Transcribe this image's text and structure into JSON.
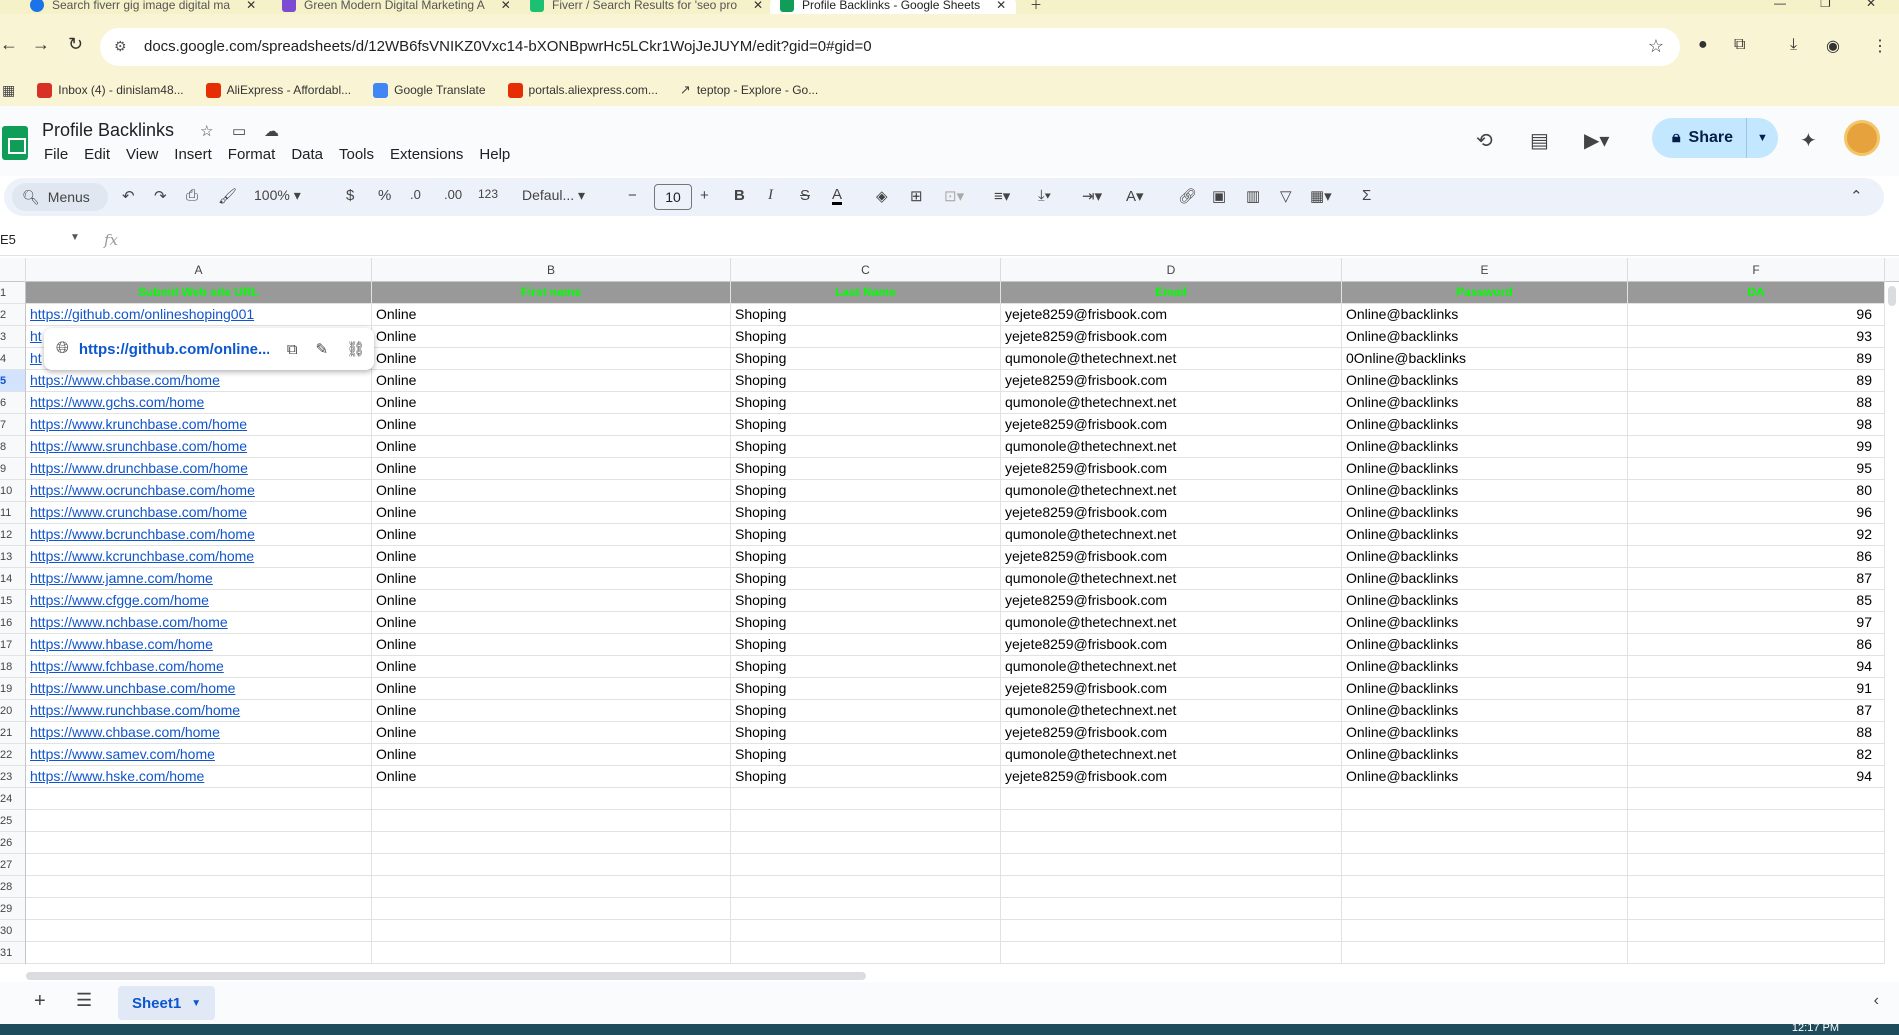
{
  "browser": {
    "tabs": [
      {
        "label": "Search fiverr gig image digital ma",
        "color": "#1a73e8"
      },
      {
        "label": "Green Modern Digital Marketing A",
        "color": "#7b4bd3"
      },
      {
        "label": "Fiverr / Search Results for 'seo pro",
        "color": "#1dbf73"
      },
      {
        "label": "Profile Backlinks - Google Sheets",
        "color": "#0f9d58"
      }
    ],
    "url": "docs.google.com/spreadsheets/d/12WB6fsVNIKZ0Vxc14-bXONBpwrHc5LCkr1WojJeJUYM/edit?gid=0#gid=0",
    "bookmarks": [
      {
        "label": "Inbox (4) - dinislam48...",
        "color": "#d93025"
      },
      {
        "label": "AliExpress - Affordabl...",
        "color": "#e62e04"
      },
      {
        "label": "Google Translate",
        "color": "#4285f4"
      },
      {
        "label": "portals.aliexpress.com...",
        "color": "#e62e04"
      },
      {
        "label": "teptop - Explore - Go...",
        "color": "#444444"
      }
    ]
  },
  "sheets": {
    "title": "Profile Backlinks",
    "menu": [
      "File",
      "Edit",
      "View",
      "Insert",
      "Format",
      "Data",
      "Tools",
      "Extensions",
      "Help"
    ],
    "share_label": "Share",
    "toolbar": {
      "menus_label": "Menus",
      "zoom": "100%",
      "currency": "$",
      "percent": "%",
      "dec_less": ".0",
      "dec_more": ".00",
      "number_format": "123",
      "font": "Defaul...",
      "font_size": "10"
    },
    "name_box": "E5",
    "fx_label": "fx",
    "columns": [
      "A",
      "B",
      "C",
      "D",
      "E",
      "F"
    ],
    "header_row": [
      "Submit Web site URL",
      "First name",
      "Last Name",
      "Email",
      "Password",
      "DA"
    ],
    "rows": [
      [
        "https://github.com/onlineshoping001",
        "Online",
        "Shoping",
        "yejete8259@frisbook.com",
        "Online@backlinks",
        "96"
      ],
      [
        "ht",
        "Online",
        "Shoping",
        "yejete8259@frisbook.com",
        "Online@backlinks",
        "93"
      ],
      [
        "ht",
        "Online",
        "Shoping",
        "qumonole@thetechnext.net",
        "0Online@backlinks",
        "89"
      ],
      [
        "https://www.chbase.com/home",
        "Online",
        "Shoping",
        "yejete8259@frisbook.com",
        "Online@backlinks",
        "89"
      ],
      [
        "https://www.gchs.com/home",
        "Online",
        "Shoping",
        "qumonole@thetechnext.net",
        "Online@backlinks",
        "88"
      ],
      [
        "https://www.krunchbase.com/home",
        "Online",
        "Shoping",
        "yejete8259@frisbook.com",
        "Online@backlinks",
        "98"
      ],
      [
        "https://www.srunchbase.com/home",
        "Online",
        "Shoping",
        "qumonole@thetechnext.net",
        "Online@backlinks",
        "99"
      ],
      [
        "https://www.drunchbase.com/home",
        "Online",
        "Shoping",
        "yejete8259@frisbook.com",
        "Online@backlinks",
        "95"
      ],
      [
        "https://www.ocrunchbase.com/home",
        "Online",
        "Shoping",
        "qumonole@thetechnext.net",
        "Online@backlinks",
        "80"
      ],
      [
        "https://www.crunchbase.com/home",
        "Online",
        "Shoping",
        "yejete8259@frisbook.com",
        "Online@backlinks",
        "96"
      ],
      [
        "https://www.bcrunchbase.com/home",
        "Online",
        "Shoping",
        "qumonole@thetechnext.net",
        "Online@backlinks",
        "92"
      ],
      [
        "https://www.kcrunchbase.com/home",
        "Online",
        "Shoping",
        "yejete8259@frisbook.com",
        "Online@backlinks",
        "86"
      ],
      [
        "https://www.jamne.com/home",
        "Online",
        "Shoping",
        "qumonole@thetechnext.net",
        "Online@backlinks",
        "87"
      ],
      [
        "https://www.cfgge.com/home",
        "Online",
        "Shoping",
        "yejete8259@frisbook.com",
        "Online@backlinks",
        "85"
      ],
      [
        "https://www.nchbase.com/home",
        "Online",
        "Shoping",
        "qumonole@thetechnext.net",
        "Online@backlinks",
        "97"
      ],
      [
        "https://www.hbase.com/home",
        "Online",
        "Shoping",
        "yejete8259@frisbook.com",
        "Online@backlinks",
        "86"
      ],
      [
        "https://www.fchbase.com/home",
        "Online",
        "Shoping",
        "qumonole@thetechnext.net",
        "Online@backlinks",
        "94"
      ],
      [
        "https://www.unchbase.com/home",
        "Online",
        "Shoping",
        "yejete8259@frisbook.com",
        "Online@backlinks",
        "91"
      ],
      [
        "https://www.runchbase.com/home",
        "Online",
        "Shoping",
        "qumonole@thetechnext.net",
        "Online@backlinks",
        "87"
      ],
      [
        "https://www.chbase.com/home",
        "Online",
        "Shoping",
        "yejete8259@frisbook.com",
        "Online@backlinks",
        "88"
      ],
      [
        "https://www.samev.com/home",
        "Online",
        "Shoping",
        "qumonole@thetechnext.net",
        "Online@backlinks",
        "82"
      ],
      [
        "https://www.hske.com/home",
        "Online",
        "Shoping",
        "yejete8259@frisbook.com",
        "Online@backlinks",
        "94"
      ]
    ],
    "row_numbers": [
      "1",
      "2",
      "3",
      "4",
      "5",
      "6",
      "7",
      "8",
      "9",
      "10",
      "11",
      "12",
      "13",
      "14",
      "15",
      "16",
      "17",
      "18",
      "19",
      "20",
      "21",
      "22",
      "23",
      "24",
      "25",
      "26",
      "27",
      "28",
      "29",
      "30",
      "31"
    ],
    "selected_row": "5",
    "link_popup": {
      "url": "https://github.com/online..."
    },
    "sheet_tab": "Sheet1",
    "colors": {
      "header_bg": "#999999",
      "header_text": "#00ff00",
      "link": "#1155cc",
      "share_bg": "#c2e7ff"
    }
  },
  "taskbar": {
    "time": "12:17 PM"
  }
}
